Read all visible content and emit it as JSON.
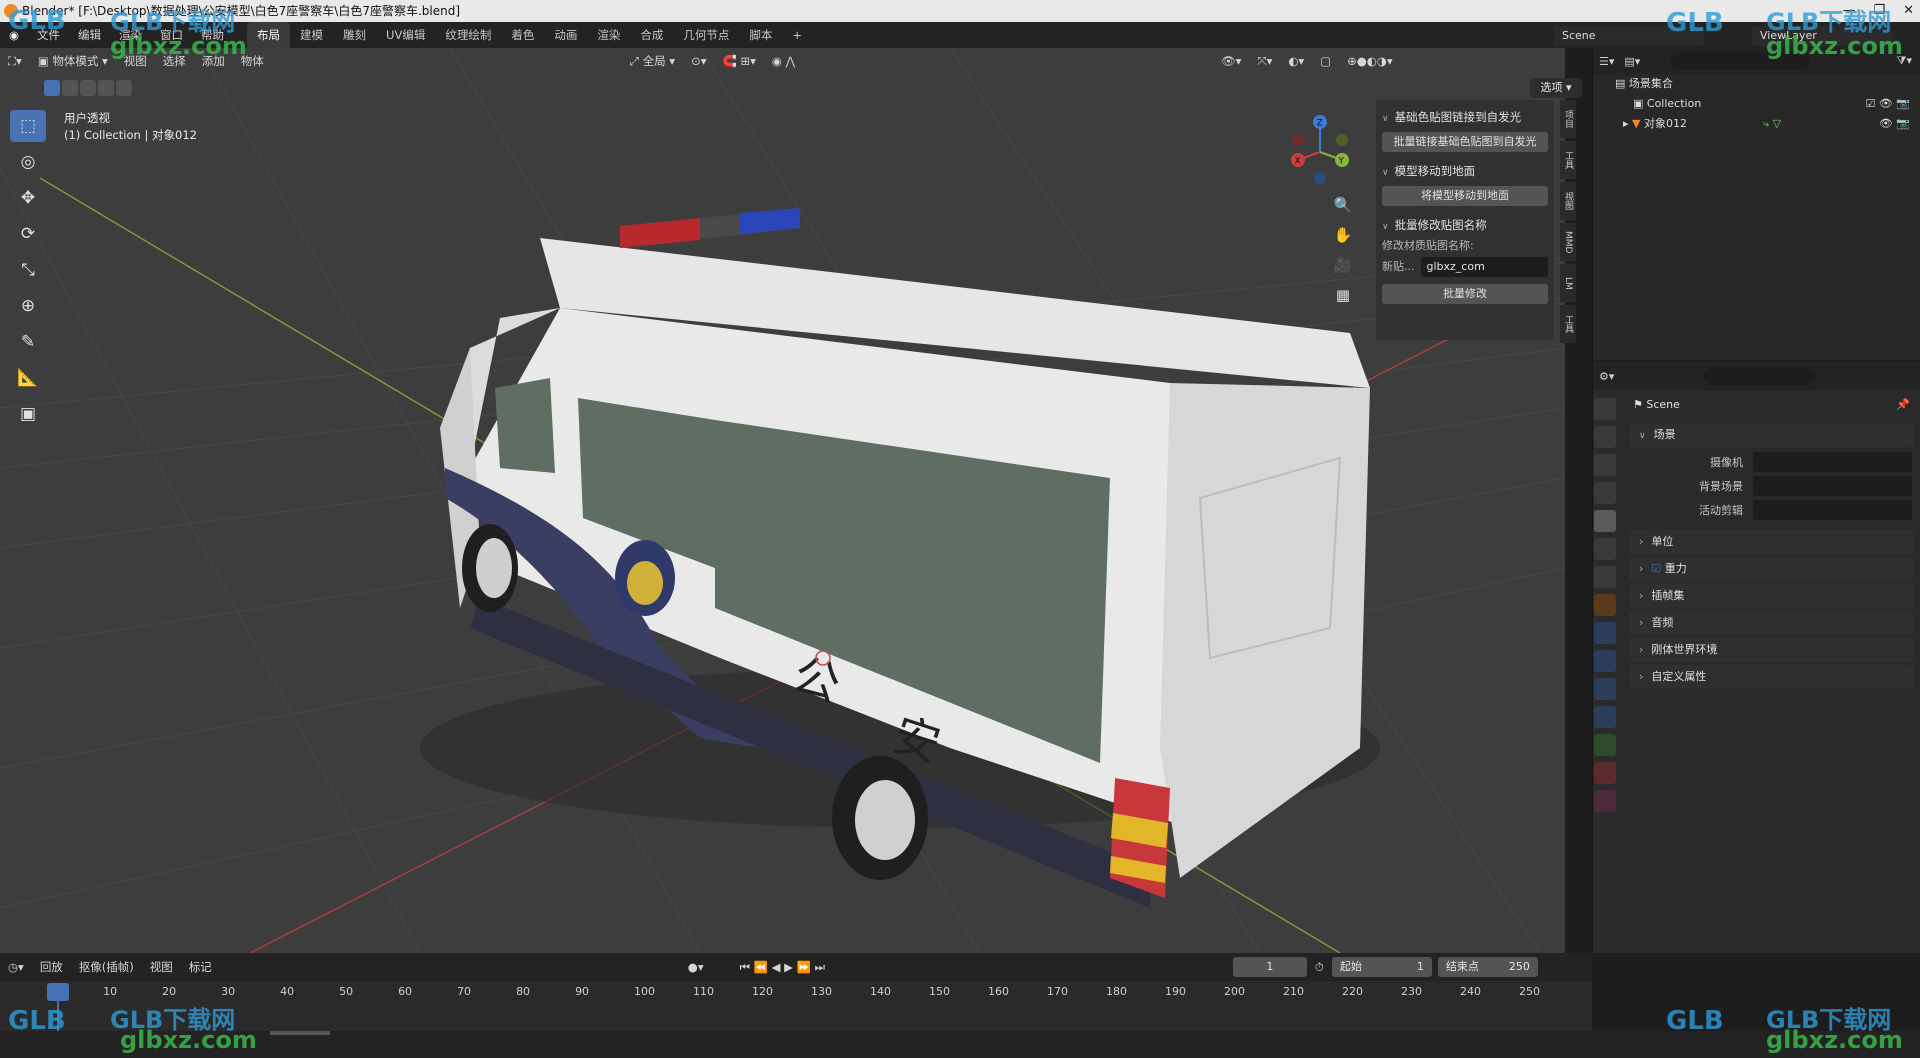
{
  "window": {
    "title": "Blender* [F:\\Desktop\\数据处理\\公安模型\\白色7座警察车\\白色7座警察车.blend]",
    "min": "—",
    "max": "❐",
    "close": "✕"
  },
  "menubar": {
    "menus": [
      "文件",
      "编辑",
      "渲染",
      "窗口",
      "帮助"
    ],
    "workspaces": [
      "布局",
      "建模",
      "雕刻",
      "UV编辑",
      "纹理绘制",
      "着色",
      "动画",
      "渲染",
      "合成",
      "几何节点",
      "脚本"
    ],
    "active_workspace": "布局",
    "add_tab": "+",
    "scene": "Scene",
    "viewlayer": "ViewLayer"
  },
  "viewport_header": {
    "mode": "物体模式",
    "menus": [
      "视图",
      "选择",
      "添加",
      "物体"
    ],
    "transform_orientation": "全局",
    "options": "选项"
  },
  "viewport": {
    "view_name": "用户透视",
    "collection_line": "(1) Collection | 对象012",
    "gizmo": {
      "x": "X",
      "y": "Y",
      "z": "Z"
    }
  },
  "tools": [
    {
      "name": "select-box-icon",
      "glyph": "⬚"
    },
    {
      "name": "cursor-icon",
      "glyph": "◎"
    },
    {
      "name": "move-icon",
      "glyph": "✥"
    },
    {
      "name": "rotate-icon",
      "glyph": "⟳"
    },
    {
      "name": "scale-icon",
      "glyph": "⤡"
    },
    {
      "name": "transform-icon",
      "glyph": "⊕"
    },
    {
      "name": "annotate-icon",
      "glyph": "✎"
    },
    {
      "name": "measure-icon",
      "glyph": "📐"
    },
    {
      "name": "add-cube-icon",
      "glyph": "▣"
    }
  ],
  "npanel": {
    "section1_title": "基础色贴图链接到自发光",
    "section1_button": "批量链接基础色贴图到自发光",
    "section2_title": "模型移动到地面",
    "section2_button": "将模型移动到地面",
    "section3_title": "批量修改贴图名称",
    "rename_label": "修改材质贴图名称:",
    "new_label": "新贴...",
    "new_value": "glbxz_com",
    "apply_button": "批量修改",
    "tabs": [
      "项目",
      "工具",
      "视图",
      "MMD",
      "LM",
      "工具"
    ]
  },
  "outliner": {
    "root": "场景集合",
    "collection": "Collection",
    "object": "对象012"
  },
  "properties": {
    "scene_name": "Scene",
    "scene_panel": "场景",
    "camera_label": "摄像机",
    "background_label": "背景场景",
    "active_clip_label": "活动剪辑",
    "panels": [
      "单位",
      "重力",
      "插帧集",
      "音频",
      "刚体世界环境",
      "自定义属性"
    ]
  },
  "timeline": {
    "menus": [
      "回放",
      "抠像(插帧)",
      "视图",
      "标记"
    ],
    "current_frame": "1",
    "start_label": "起始",
    "start_value": "1",
    "end_label": "结束点",
    "end_value": "250",
    "ticks": [
      "1",
      "10",
      "20",
      "30",
      "40",
      "50",
      "60",
      "70",
      "80",
      "90",
      "100",
      "110",
      "120",
      "130",
      "140",
      "150",
      "160",
      "170",
      "180",
      "190",
      "200",
      "210",
      "220",
      "230",
      "240",
      "250"
    ]
  },
  "watermark": {
    "brand": "GLB下载网",
    "url": "glbxz.com",
    "logo": "GLB"
  },
  "vehicle": {
    "side_text_1": "公",
    "side_text_2": "安"
  },
  "colors": {
    "accent": "#4772b3",
    "viewport": "#3d3d3d",
    "x_axis": "#c94040",
    "y_axis": "#8ab33a",
    "z_axis": "#3e7bd6"
  }
}
